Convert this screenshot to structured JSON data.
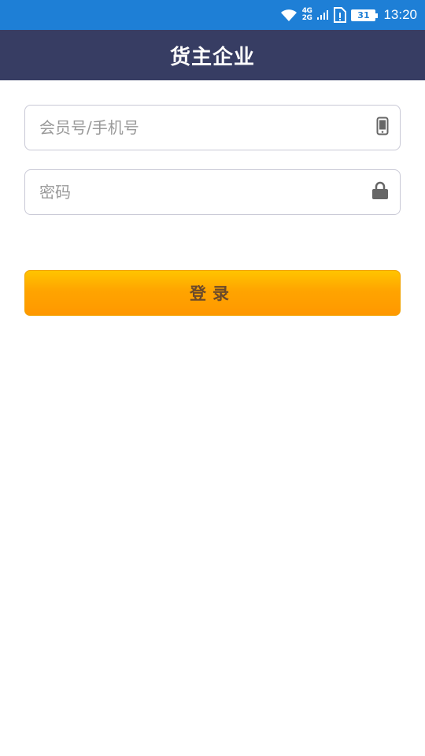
{
  "status_bar": {
    "network_top": "4G",
    "network_bottom": "2G",
    "battery": "31",
    "time": "13:20",
    "icons": [
      "wifi-icon",
      "signal-icon",
      "sim-alert-icon",
      "battery-icon"
    ]
  },
  "header": {
    "title": "货主企业"
  },
  "form": {
    "account_placeholder": "会员号/手机号",
    "account_value": "",
    "password_placeholder": "密码",
    "password_value": "",
    "account_icon": "phone-icon",
    "password_icon": "lock-icon"
  },
  "login_button": {
    "label": "登录"
  },
  "colors": {
    "status_bar": "#1e7fd6",
    "header": "#373d63",
    "button_top": "#ffc400",
    "button_bottom": "#ff9800",
    "button_text": "#6b4a2a",
    "input_border": "#c9c9d6",
    "icon": "#666666"
  }
}
